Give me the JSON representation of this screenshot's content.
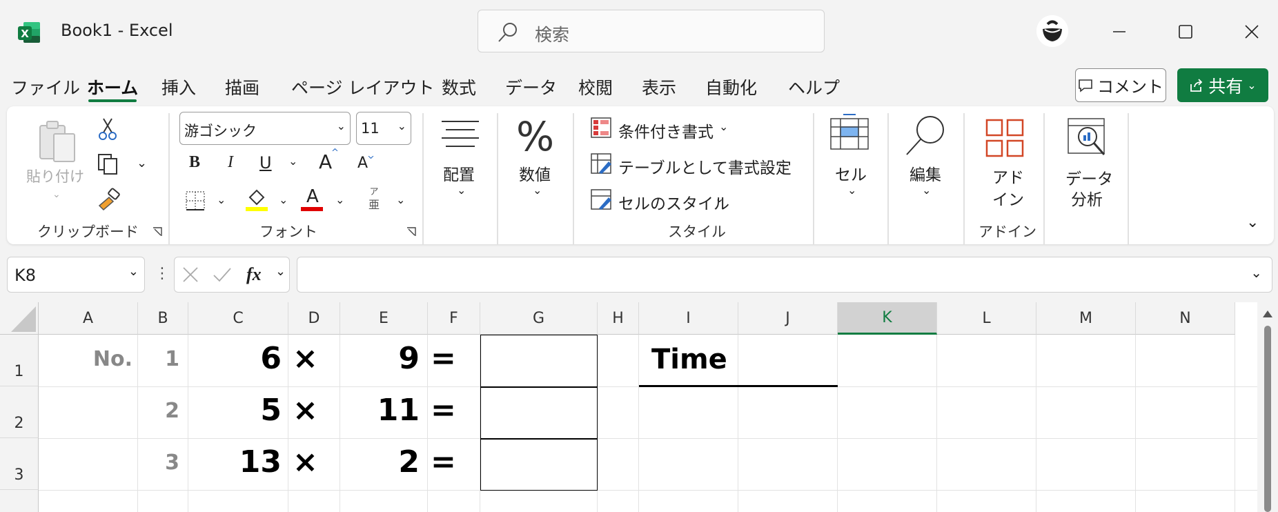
{
  "window": {
    "title": "Book1  -  Excel",
    "search_placeholder": "検索"
  },
  "menu_tabs": [
    "ファイル",
    "ホーム",
    "挿入",
    "描画",
    "ページ レイアウト",
    "数式",
    "データ",
    "校閲",
    "表示",
    "自動化",
    "ヘルプ"
  ],
  "active_tab": "ホーム",
  "buttons": {
    "comment": "コメント",
    "share": "共有"
  },
  "ribbon": {
    "clipboard": {
      "paste": "貼り付け",
      "label": "クリップボード"
    },
    "font": {
      "name": "游ゴシック",
      "size": "11",
      "bold": "B",
      "italic": "I",
      "underline": "U",
      "grow": "A",
      "shrink": "A",
      "font_color": "A",
      "phonetic_top": "ア",
      "phonetic_bottom": "亜",
      "label": "フォント"
    },
    "alignment": {
      "label": "配置"
    },
    "number": {
      "label": "数値",
      "symbol": "%"
    },
    "styles": {
      "conditional": "条件付き書式",
      "table": "テーブルとして書式設定",
      "cell_styles": "セルのスタイル",
      "label": "スタイル"
    },
    "cells": {
      "label": "セル"
    },
    "editing": {
      "label": "編集"
    },
    "addins": {
      "btn_line1": "アド",
      "btn_line2": "イン",
      "label": "アドイン"
    },
    "analysis": {
      "line1": "データ",
      "line2": "分析"
    }
  },
  "formula_bar": {
    "name_box": "K8",
    "fx": "fx",
    "formula": ""
  },
  "columns": [
    "A",
    "B",
    "C",
    "D",
    "E",
    "F",
    "G",
    "H",
    "I",
    "J",
    "K",
    "L",
    "M",
    "N"
  ],
  "selected_column": "K",
  "rows": [
    "1",
    "2",
    "3"
  ],
  "cells": {
    "A1": "No.",
    "B1": "1",
    "B2": "2",
    "B3": "3",
    "C1": "6",
    "C2": "5",
    "C3": "13",
    "D1": "×",
    "D2": "×",
    "D3": "×",
    "E1": "9",
    "E2": "11",
    "E3": "2",
    "F1": "=",
    "F2": "=",
    "F3": "=",
    "I1": "Time"
  },
  "colors": {
    "accent": "#107c41",
    "highlight_yellow": "#ffff00",
    "font_red": "#e00000"
  }
}
